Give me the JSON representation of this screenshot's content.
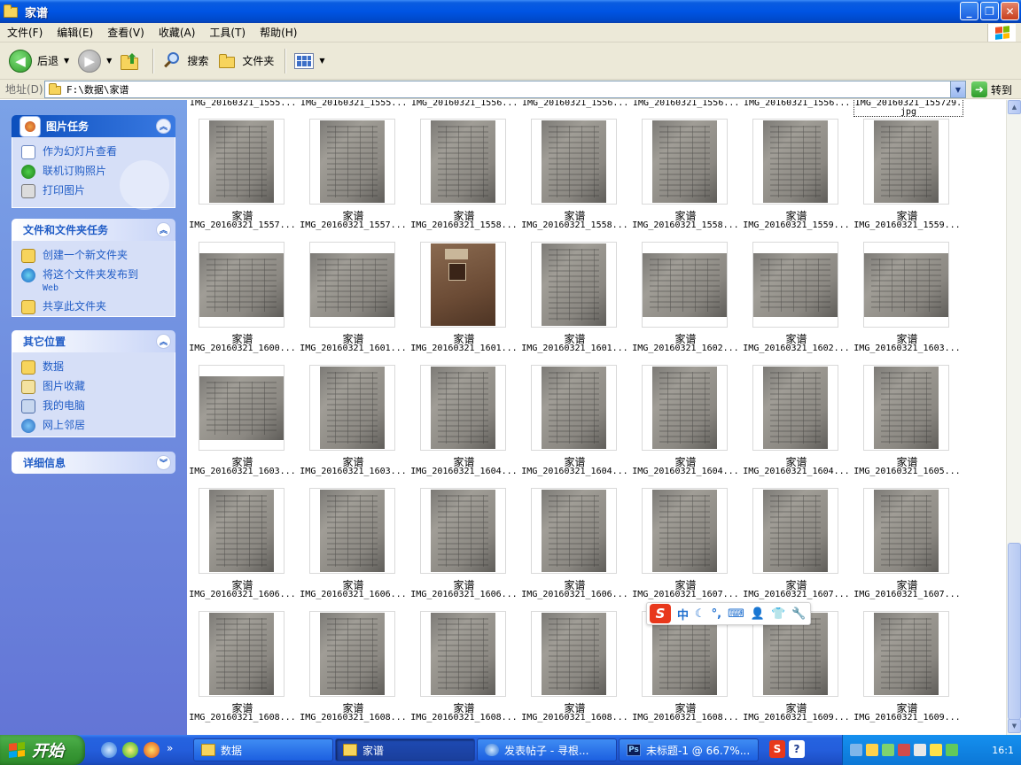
{
  "window": {
    "title": "家谱"
  },
  "menu": [
    "文件(F)",
    "编辑(E)",
    "查看(V)",
    "收藏(A)",
    "工具(T)",
    "帮助(H)"
  ],
  "toolbar": {
    "back_label": "后退",
    "search_label": "搜索",
    "folders_label": "文件夹"
  },
  "address": {
    "label": "地址(D)",
    "path": "F:\\数据\\家谱",
    "go_label": "转到"
  },
  "left_pane": {
    "picture_tasks": {
      "title": "图片任务",
      "items": [
        "作为幻灯片查看",
        "联机订购照片",
        "打印图片"
      ]
    },
    "file_tasks": {
      "title": "文件和文件夹任务",
      "items": [
        "创建一个新文件夹",
        "将这个文件夹发布到",
        "Web",
        "共享此文件夹"
      ]
    },
    "other_places": {
      "title": "其它位置",
      "items": [
        "数据",
        "图片收藏",
        "我的电脑",
        "网上邻居"
      ]
    },
    "details": {
      "title": "详细信息"
    }
  },
  "content": {
    "top_captions": [
      "IMG_20160321_1555...",
      "IMG_20160321_1555...",
      "IMG_20160321_1556...",
      "IMG_20160321_1556...",
      "IMG_20160321_1556...",
      "IMG_20160321_1556...",
      "IMG_20160321_155729.",
      "jpg"
    ],
    "thumbs": [
      {
        "name1": "家谱",
        "name2": "IMG_20160321_1557...",
        "kind": "portrait"
      },
      {
        "name1": "家谱",
        "name2": "IMG_20160321_1557...",
        "kind": "portrait"
      },
      {
        "name1": "家谱",
        "name2": "IMG_20160321_1558...",
        "kind": "portrait"
      },
      {
        "name1": "家谱",
        "name2": "IMG_20160321_1558...",
        "kind": "portrait"
      },
      {
        "name1": "家谱",
        "name2": "IMG_20160321_1558...",
        "kind": "portrait"
      },
      {
        "name1": "家谱",
        "name2": "IMG_20160321_1559...",
        "kind": "portrait"
      },
      {
        "name1": "家谱",
        "name2": "IMG_20160321_1559...",
        "kind": "portrait"
      },
      {
        "name1": "家谱",
        "name2": "IMG_20160321_1600...",
        "kind": "landscape"
      },
      {
        "name1": "家谱",
        "name2": "IMG_20160321_1601...",
        "kind": "landscape"
      },
      {
        "name1": "家谱",
        "name2": "IMG_20160321_1601...",
        "kind": "cover"
      },
      {
        "name1": "家谱",
        "name2": "IMG_20160321_1601...",
        "kind": "portrait"
      },
      {
        "name1": "家谱",
        "name2": "IMG_20160321_1602...",
        "kind": "landscape"
      },
      {
        "name1": "家谱",
        "name2": "IMG_20160321_1602...",
        "kind": "landscape"
      },
      {
        "name1": "家谱",
        "name2": "IMG_20160321_1603...",
        "kind": "landscape"
      },
      {
        "name1": "家谱",
        "name2": "IMG_20160321_1603...",
        "kind": "landscape"
      },
      {
        "name1": "家谱",
        "name2": "IMG_20160321_1603...",
        "kind": "portrait"
      },
      {
        "name1": "家谱",
        "name2": "IMG_20160321_1604...",
        "kind": "portrait"
      },
      {
        "name1": "家谱",
        "name2": "IMG_20160321_1604...",
        "kind": "portrait"
      },
      {
        "name1": "家谱",
        "name2": "IMG_20160321_1604...",
        "kind": "portrait"
      },
      {
        "name1": "家谱",
        "name2": "IMG_20160321_1604...",
        "kind": "portrait"
      },
      {
        "name1": "家谱",
        "name2": "IMG_20160321_1605...",
        "kind": "portrait"
      },
      {
        "name1": "家谱",
        "name2": "IMG_20160321_1606...",
        "kind": "portrait"
      },
      {
        "name1": "家谱",
        "name2": "IMG_20160321_1606...",
        "kind": "portrait"
      },
      {
        "name1": "家谱",
        "name2": "IMG_20160321_1606...",
        "kind": "portrait"
      },
      {
        "name1": "家谱",
        "name2": "IMG_20160321_1606...",
        "kind": "portrait"
      },
      {
        "name1": "家谱",
        "name2": "IMG_20160321_1607...",
        "kind": "portrait"
      },
      {
        "name1": "家谱",
        "name2": "IMG_20160321_1607...",
        "kind": "portrait"
      },
      {
        "name1": "家谱",
        "name2": "IMG_20160321_1607...",
        "kind": "portrait"
      },
      {
        "name1": "家谱",
        "name2": "IMG_20160321_1608...",
        "kind": "portrait"
      },
      {
        "name1": "家谱",
        "name2": "IMG_20160321_1608...",
        "kind": "portrait"
      },
      {
        "name1": "家谱",
        "name2": "IMG_20160321_1608...",
        "kind": "portrait"
      },
      {
        "name1": "家谱",
        "name2": "IMG_20160321_1608...",
        "kind": "portrait"
      },
      {
        "name1": "家谱",
        "name2": "IMG_20160321_1608...",
        "kind": "portrait"
      },
      {
        "name1": "家谱",
        "name2": "IMG_20160321_1609...",
        "kind": "portrait"
      },
      {
        "name1": "家谱",
        "name2": "IMG_20160321_1609...",
        "kind": "portrait"
      }
    ]
  },
  "ime": {
    "logo": "S",
    "mode": "中"
  },
  "taskbar": {
    "start_label": "开始",
    "buttons": [
      {
        "label": "数据",
        "icon": "folder"
      },
      {
        "label": "家谱",
        "icon": "folder"
      },
      {
        "label": "发表帖子 - 寻根...",
        "icon": "ie"
      },
      {
        "label": "未标题-1 @ 66.7%...",
        "icon": "ps"
      }
    ],
    "clock": "16:1"
  },
  "colors": {
    "xp_blue": "#0054e3",
    "pane_blue": "#6375d6",
    "link_blue": "#215dc6"
  }
}
